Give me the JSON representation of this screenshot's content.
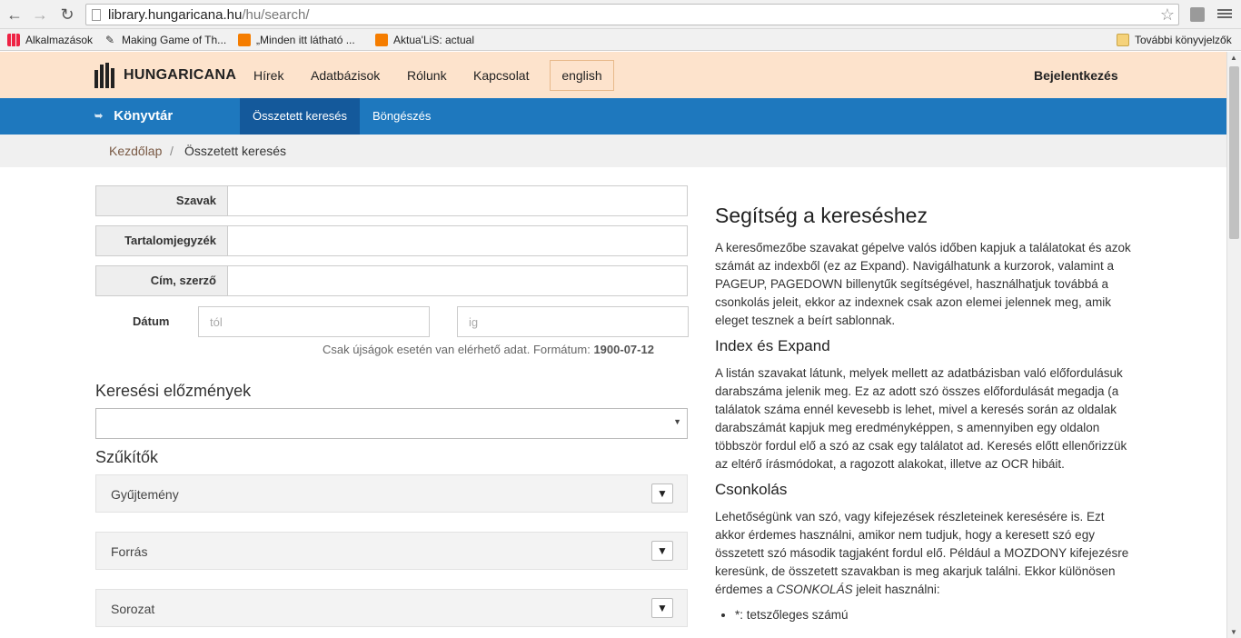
{
  "browser": {
    "url_host": "library.hungaricana.hu",
    "url_path": "/hu/search/",
    "bookmarks": [
      {
        "label": "Alkalmazások",
        "icon": "apps-icon"
      },
      {
        "label": "Making Game of Th...",
        "icon": "pin-icon"
      },
      {
        "label": "„Minden itt látható ...",
        "icon": "blogger-icon"
      },
      {
        "label": "Aktua'LiS: actual",
        "icon": "blogger-icon"
      }
    ],
    "other_bookmarks": "További könyvjelzők"
  },
  "header": {
    "logo_text": "HUNGARICANA",
    "nav": [
      "Hírek",
      "Adatbázisok",
      "Rólunk",
      "Kapcsolat"
    ],
    "lang_button": "english",
    "login": "Bejelentkezés"
  },
  "subnav": {
    "section": "Könyvtár",
    "tabs": [
      "Összetett keresés",
      "Böngészés"
    ]
  },
  "breadcrumb": {
    "home": "Kezdőlap",
    "separator": "/",
    "current": "Összetett keresés"
  },
  "form": {
    "fields": [
      "Szavak",
      "Tartalomjegyzék",
      "Cím, szerző"
    ],
    "date_label": "Dátum",
    "date_from_placeholder": "tól",
    "date_to_placeholder": "ig",
    "date_hint": "Csak újságok esetén van elérhető adat. Formátum:",
    "date_format": "1900-07-12",
    "history_heading": "Keresési előzmények",
    "filters_heading": "Szűkítők",
    "filters": [
      "Gyűjtemény",
      "Forrás",
      "Sorozat"
    ]
  },
  "help": {
    "title": "Segítség a kereséshez",
    "p1": "A keresőmezőbe szavakat gépelve valós időben kapjuk a találatokat és azok számát az indexből (ez az Expand). Navigálhatunk a kurzorok, valamint a PAGEUP, PAGEDOWN billenytűk segítségével, használhatjuk továbbá a csonkolás jeleit, ekkor az indexnek csak azon elemei jelennek meg, amik eleget tesznek a beírt sablonnak.",
    "h_index": "Index és Expand",
    "p2": "A listán szavakat látunk, melyek mellett az adatbázisban való előfordulásuk darabszáma jelenik meg. Ez az adott szó összes előfordulását megadja (a találatok száma ennél kevesebb is lehet, mivel a keresés során az oldalak darabszámát kapjuk meg eredményképpen, s amennyiben egy oldalon többször fordul elő a szó az csak egy találatot ad. Keresés előtt ellenőrizzük az eltérő írásmódokat, a ragozott alakokat, illetve az OCR hibáit.",
    "h_trunc": "Csonkolás",
    "p3_a": "Lehetőségünk van szó, vagy kifejezések részleteinek keresésére is. Ezt akkor érdemes használni, amikor nem tudjuk, hogy a keresett szó egy összetett szó második tagjaként fordul elő. Például a MOZDONY kifejezésre keresünk, de összetett szavakban is meg akarjuk találni. Ekkor különösen érdemes a ",
    "p3_em": "CSONKOLÁS",
    "p3_b": " jeleit használni:",
    "list_item": "*: tetszőleges számú"
  }
}
